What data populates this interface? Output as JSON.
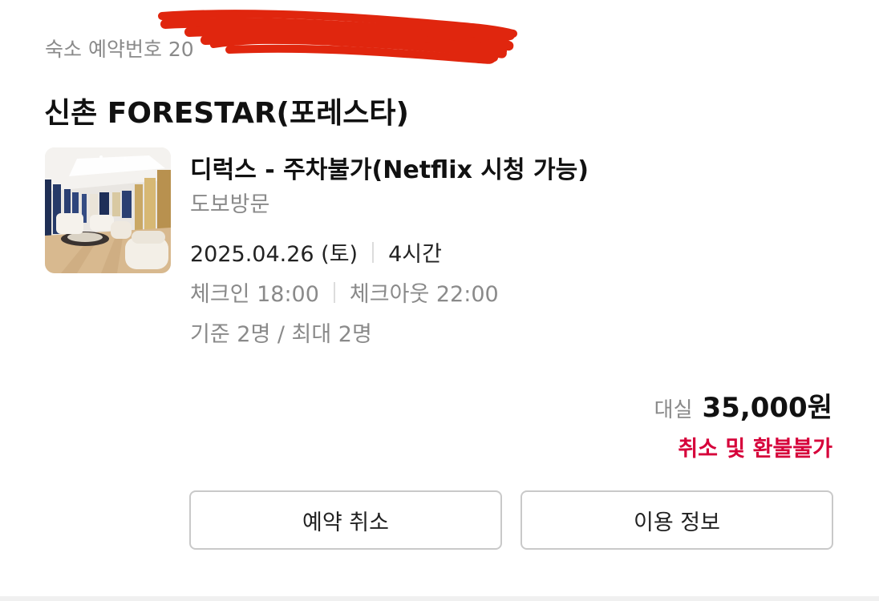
{
  "booking": {
    "number_label": "숙소 예약번호",
    "number_value": "20"
  },
  "property": {
    "name": "신촌 FORESTAR(포레스타)"
  },
  "room": {
    "name": "디럭스 - 주차불가(Netflix 시청 가능)",
    "visit_type": "도보방문",
    "date": "2025.04.26 (토)",
    "duration": "4시간",
    "checkin": "체크인 18:00",
    "checkout": "체크아웃 22:00",
    "capacity": "기준 2명 / 최대 2명"
  },
  "price": {
    "label": "대실",
    "value": "35,000원",
    "refund_note": "취소 및 환불불가"
  },
  "actions": {
    "cancel_label": "예약 취소",
    "info_label": "이용 정보"
  },
  "colors": {
    "accent_red": "#d6003a",
    "redaction": "#e0260e",
    "muted_text": "#8a8a8a",
    "button_border": "#c9c9c9"
  }
}
